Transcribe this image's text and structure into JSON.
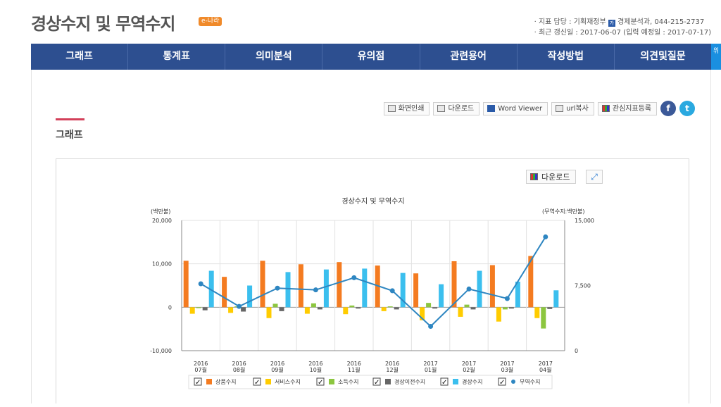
{
  "header": {
    "title": "경상수지 및 무역수지",
    "badge": "e-나라",
    "meta_line1_prefix": "· 지표 담당 : 기획재정부",
    "meta_chip": "가",
    "meta_line1_suffix": "경제분석과, 044-215-2737",
    "meta_line2": "· 최근 갱신일 : 2017-06-07 (입력 예정일 : 2017-07-17)"
  },
  "nav": {
    "tabs": [
      "그래프",
      "통계표",
      "의미분석",
      "유의점",
      "관련용어",
      "작성방법",
      "의견및질문"
    ],
    "side_button": "위"
  },
  "toolbar": {
    "print": "화면인쇄",
    "download": "다운로드",
    "word": "Word Viewer",
    "url": "url복사",
    "favorite": "관심지표등록",
    "facebook": "f",
    "twitter": "t"
  },
  "section": {
    "title": "그래프"
  },
  "chart_toolbar": {
    "download": "다운로드",
    "expand": "⤢"
  },
  "colors": {
    "goods": "#f47b20",
    "services": "#ffcc00",
    "income": "#8cc63f",
    "transfer": "#666666",
    "current": "#3bbfee",
    "trade": "#2e86c1"
  },
  "chart_data": {
    "type": "bar",
    "title": "경상수지 및 무역수지",
    "ylabel_left": "(백만불)",
    "ylabel_right": "(무역수지:백만불)",
    "ylim_left": [
      -10000,
      20000
    ],
    "yticks_left": [
      -10000,
      0,
      10000,
      20000
    ],
    "ytick_labels_left": [
      "-10,000",
      "0",
      "10,000",
      "20,000"
    ],
    "ylim_right": [
      0,
      15000
    ],
    "yticks_right": [
      0,
      7500,
      15000
    ],
    "ytick_labels_right": [
      "0",
      "7,500",
      "15,000"
    ],
    "categories": [
      [
        "2016",
        "07월"
      ],
      [
        "2016",
        "08월"
      ],
      [
        "2016",
        "09월"
      ],
      [
        "2016",
        "10월"
      ],
      [
        "2016",
        "11월"
      ],
      [
        "2016",
        "12월"
      ],
      [
        "2017",
        "01월"
      ],
      [
        "2017",
        "02월"
      ],
      [
        "2017",
        "03월"
      ],
      [
        "2017",
        "04월"
      ]
    ],
    "grid": true,
    "legend_position": "bottom",
    "series": [
      {
        "name": "상품수지",
        "kind": "bar",
        "axis": "left",
        "color_key": "goods",
        "values": [
          10700,
          7000,
          10700,
          9900,
          10400,
          9600,
          7800,
          10600,
          9700,
          11800
        ]
      },
      {
        "name": "서비스수지",
        "kind": "bar",
        "axis": "left",
        "color_key": "services",
        "values": [
          -1500,
          -1300,
          -2500,
          -1500,
          -1600,
          -900,
          -3000,
          -2200,
          -3300,
          -2500
        ]
      },
      {
        "name": "소득수지",
        "kind": "bar",
        "axis": "left",
        "color_key": "income",
        "values": [
          -200,
          200,
          800,
          900,
          400,
          200,
          1000,
          600,
          -500,
          -4900
        ]
      },
      {
        "name": "경상이전수지",
        "kind": "bar",
        "axis": "left",
        "color_key": "transfer",
        "values": [
          -700,
          -1000,
          -900,
          -500,
          -300,
          -500,
          -300,
          -500,
          -300,
          -400
        ]
      },
      {
        "name": "경상수지",
        "kind": "bar",
        "axis": "left",
        "color_key": "current",
        "values": [
          8400,
          5000,
          8100,
          8700,
          8900,
          7900,
          5300,
          8400,
          5900,
          3900
        ]
      },
      {
        "name": "무역수지",
        "kind": "line",
        "axis": "right",
        "color_key": "trade",
        "values": [
          7700,
          5100,
          7200,
          7000,
          8400,
          6900,
          2800,
          7100,
          6000,
          13100
        ]
      }
    ]
  }
}
